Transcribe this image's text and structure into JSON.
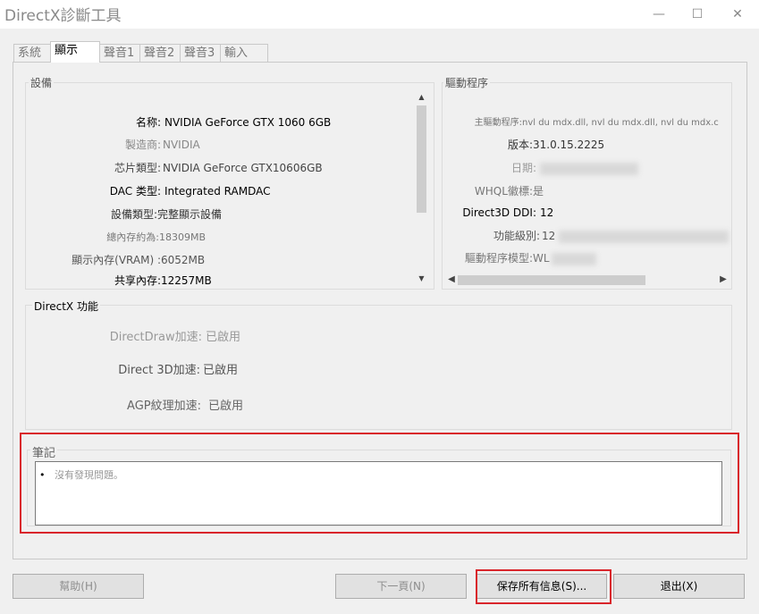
{
  "window": {
    "title": "DirectX診斷工具",
    "minimize_glyph": "—",
    "maximize_glyph": "☐",
    "close_glyph": "✕"
  },
  "tabs": [
    {
      "label": "系統"
    },
    {
      "label": "顯示",
      "active": true
    },
    {
      "label": "聲音1"
    },
    {
      "label": "聲音2"
    },
    {
      "label": "聲音3"
    },
    {
      "label": "輸入"
    }
  ],
  "device": {
    "group_label": "設備",
    "rows": [
      {
        "label": "名称:",
        "value": "NVIDIA GeForce GTX 1060 6GB"
      },
      {
        "label": "製造商:",
        "value": "NVIDIA"
      },
      {
        "label": "芯片類型:",
        "value": "NVIDIA GeForce GTX10606GB"
      },
      {
        "label": "DAC 类型:",
        "value": "Integrated RAMDAC"
      },
      {
        "label": "設備類型:",
        "value": "完整顯示設備"
      },
      {
        "label": "總內存約為:",
        "value": "18309MB"
      },
      {
        "label": "顯示內存(VRAM) :",
        "value": "6052MB"
      },
      {
        "label": "共享內存:",
        "value": "12257MB"
      }
    ]
  },
  "driver": {
    "group_label": "驅動程序",
    "rows": [
      {
        "label": "主驅動程序:",
        "value": "nvl du mdx.dll, nvl du mdx.dll, nvl du mdx.c"
      },
      {
        "label": "版本:",
        "value": "31.0.15.2225"
      },
      {
        "label": "日期:",
        "value": ""
      },
      {
        "label": "WHQL徽標:",
        "value": "是"
      },
      {
        "label": "Direct3D DDI:",
        "value": "12"
      },
      {
        "label": "功能級別:",
        "value": "12"
      },
      {
        "label": "驅動程序模型:",
        "value": "WL"
      }
    ]
  },
  "directx_features": {
    "group_label": "DirectX 功能",
    "rows": [
      {
        "label": "DirectDraw加速:",
        "value": "已啟用"
      },
      {
        "label": "Direct 3D加速:",
        "value": "已啟用"
      },
      {
        "label": "AGP紋理加速:",
        "value": "已啟用"
      }
    ]
  },
  "notes": {
    "group_label": "筆記",
    "items": [
      "沒有發現問題。"
    ]
  },
  "buttons": {
    "help": "幫助(H)",
    "next": "下一頁(N)",
    "save_all": "保存所有信息(S)...",
    "exit": "退出(X)"
  },
  "colors": {
    "highlight_red": "#d9252b",
    "window_bg": "#f0f0f0"
  }
}
